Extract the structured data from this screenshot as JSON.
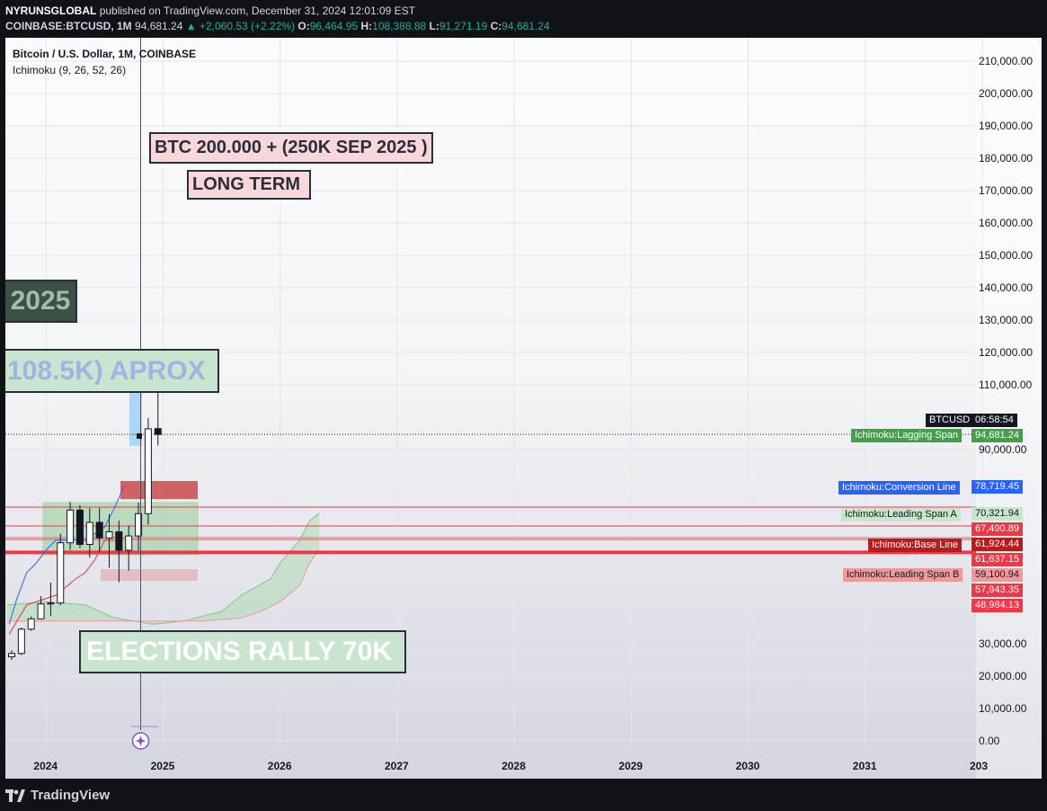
{
  "header": {
    "publisher": "NYRUNSGLOBAL",
    "published": "published on TradingView.com, December 31, 2024 12:01:09 EST",
    "symbol_line": "COINBASE:BTCUSD, 1M",
    "last": "94,681.24",
    "change": "▲ +2,060.53 (+2.22%)",
    "o_label": "O:",
    "o": "96,464.95",
    "h_label": "H:",
    "h": "108,388.88",
    "l_label": "L:",
    "l": "91,271.19",
    "c_label": "C:",
    "c": "94,681.24"
  },
  "legend": {
    "title": "Bitcoin / U.S. Dollar, 1M, COINBASE",
    "indicator": "Ichimoku (9, 26, 52, 26)"
  },
  "annotations": {
    "target": "BTC 200.000 + (250K SEP 2025 )",
    "long_term": "LONG TERM",
    "year": "2025",
    "approx": "108.5K) APROX",
    "elections": "ELECTIONS RALLY 70K"
  },
  "price_tags": {
    "symbol": "BTCUSD",
    "countdown": "06:58:54",
    "lagging_label": "Ichimoku:Lagging Span",
    "lagging_value": "94,681.24",
    "conversion_label": "Ichimoku:Conversion Line",
    "conversion_value": "78,719.45",
    "span_a_label": "Ichimoku:Leading Span A",
    "span_a_value": "70,321.94",
    "level_1": "67,490.89",
    "base_label": "Ichimoku:Base Line",
    "base_value": "61,924.44",
    "level_2": "61,637.15",
    "span_b_label": "Ichimoku:Leading Span B",
    "span_b_value": "59,100.94",
    "level_3": "57,943.35",
    "level_4": "48,984.13"
  },
  "footer": {
    "brand": "TradingView"
  },
  "colors": {
    "up_candle": "#ffffff",
    "down_candle": "#131722",
    "conversion": "#2962ff",
    "base": "#e5333f",
    "lagging": "#43a047",
    "cloud_green": "#a5d6a7",
    "red_line": "#f23645"
  },
  "chart_data": {
    "type": "candlestick",
    "title": "Bitcoin / U.S. Dollar, 1M, COINBASE",
    "x_ticks": [
      "2024",
      "2025",
      "2026",
      "2027",
      "2028",
      "2029",
      "2030",
      "2031",
      "203"
    ],
    "y_ticks": [
      "210,000.00",
      "200,000.00",
      "190,000.00",
      "180,000.00",
      "170,000.00",
      "160,000.00",
      "150,000.00",
      "140,000.00",
      "130,000.00",
      "120,000.00",
      "110,000.00",
      "90,000.00",
      "30,000.00",
      "20,000.00",
      "10,000.00",
      "0.00"
    ],
    "ylim": [
      0,
      213000
    ],
    "candles": [
      {
        "t": "2023-09",
        "o": 26000,
        "h": 28000,
        "l": 25000,
        "c": 27000
      },
      {
        "t": "2023-10",
        "o": 27000,
        "h": 35000,
        "l": 26500,
        "c": 34500
      },
      {
        "t": "2023-11",
        "o": 34500,
        "h": 38400,
        "l": 34000,
        "c": 37700
      },
      {
        "t": "2023-12",
        "o": 37700,
        "h": 44700,
        "l": 37600,
        "c": 42300
      },
      {
        "t": "2024-01",
        "o": 42300,
        "h": 48900,
        "l": 38500,
        "c": 42600
      },
      {
        "t": "2024-02",
        "o": 42600,
        "h": 64000,
        "l": 41900,
        "c": 61200
      },
      {
        "t": "2024-03",
        "o": 61200,
        "h": 73800,
        "l": 59000,
        "c": 71300
      },
      {
        "t": "2024-04",
        "o": 71300,
        "h": 72800,
        "l": 59600,
        "c": 60700
      },
      {
        "t": "2024-05",
        "o": 60700,
        "h": 71900,
        "l": 56600,
        "c": 67500
      },
      {
        "t": "2024-06",
        "o": 67500,
        "h": 72000,
        "l": 58400,
        "c": 62700
      },
      {
        "t": "2024-07",
        "o": 62700,
        "h": 70000,
        "l": 53500,
        "c": 64600
      },
      {
        "t": "2024-08",
        "o": 64600,
        "h": 68000,
        "l": 49000,
        "c": 58900
      },
      {
        "t": "2024-09",
        "o": 58900,
        "h": 66500,
        "l": 52600,
        "c": 63300
      },
      {
        "t": "2024-10",
        "o": 63300,
        "h": 73600,
        "l": 58800,
        "c": 70200
      },
      {
        "t": "2024-11",
        "o": 70200,
        "h": 99800,
        "l": 66800,
        "c": 96400
      },
      {
        "t": "2024-12",
        "o": 96464.95,
        "h": 108388.88,
        "l": 91271.19,
        "c": 94681.24
      }
    ],
    "conversion_line": [
      [
        0.2,
        36000
      ],
      [
        1,
        44000
      ],
      [
        2,
        52000
      ],
      [
        3,
        55000
      ],
      [
        4,
        59000
      ],
      [
        5,
        62000
      ],
      [
        6,
        62000
      ],
      [
        7,
        62000
      ],
      [
        8,
        62000
      ],
      [
        9,
        64000
      ],
      [
        10,
        66000
      ],
      [
        11,
        72000
      ],
      [
        12,
        78719.45
      ]
    ],
    "base_line": [
      [
        0.2,
        33000
      ],
      [
        2,
        42000
      ],
      [
        5,
        45000
      ],
      [
        7,
        50000
      ],
      [
        8,
        52000
      ],
      [
        9,
        56000
      ],
      [
        10,
        62000
      ],
      [
        11,
        61924.44
      ]
    ],
    "leading_span_a": [
      [
        0,
        42000
      ],
      [
        4,
        43000
      ],
      [
        8,
        42000
      ],
      [
        11,
        38000
      ],
      [
        15,
        36000
      ],
      [
        18,
        37000
      ],
      [
        22,
        40000
      ],
      [
        24,
        45000
      ],
      [
        27,
        50000
      ],
      [
        28,
        55000
      ],
      [
        30,
        62000
      ],
      [
        31,
        68000
      ],
      [
        32,
        70321.94
      ]
    ],
    "leading_span_b": [
      [
        0,
        37000
      ],
      [
        10,
        37000
      ],
      [
        15,
        37000
      ],
      [
        20,
        37000
      ],
      [
        24,
        38000
      ],
      [
        26,
        40000
      ],
      [
        28,
        43000
      ],
      [
        30,
        48000
      ],
      [
        31,
        55000
      ],
      [
        32,
        59100.94
      ]
    ],
    "horizontal_levels": [
      67490.89,
      61637.15,
      57943.35
    ],
    "last_price": 94681.24
  }
}
